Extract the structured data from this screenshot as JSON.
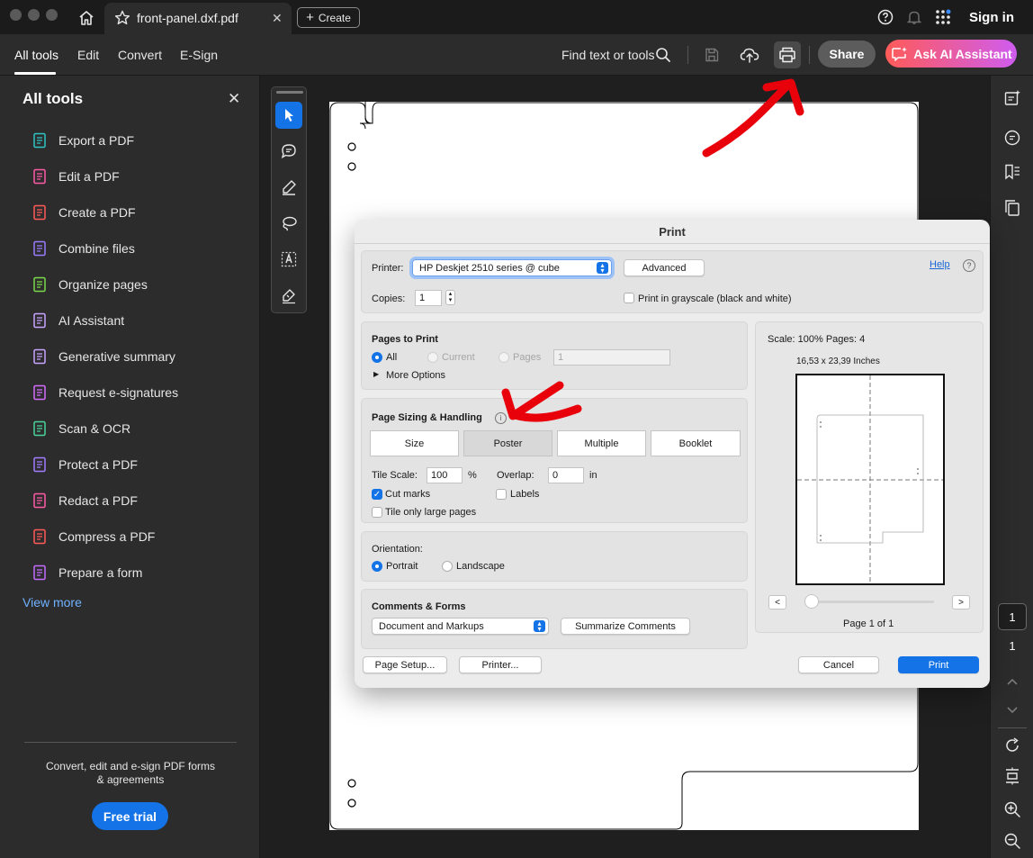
{
  "titlebar": {
    "doc_tab": "front-panel.dxf.pdf",
    "close_glyph": "✕",
    "create_label": "Create",
    "signin_label": "Sign in"
  },
  "toolbar": {
    "tabs": [
      {
        "label": "All tools"
      },
      {
        "label": "Edit"
      },
      {
        "label": "Convert"
      },
      {
        "label": "E-Sign"
      }
    ],
    "find_label": "Find text or tools",
    "share_label": "Share",
    "ai_label": "Ask AI Assistant"
  },
  "left_panel": {
    "title": "All tools",
    "close_glyph": "✕",
    "items": [
      {
        "label": "Export a PDF",
        "icon": "export-pdf-icon",
        "color": "#2ec5c5"
      },
      {
        "label": "Edit a PDF",
        "icon": "edit-pdf-icon",
        "color": "#ff5aa8"
      },
      {
        "label": "Create a PDF",
        "icon": "create-pdf-icon",
        "color": "#ff5a5a"
      },
      {
        "label": "Combine files",
        "icon": "combine-files-icon",
        "color": "#9a7bff"
      },
      {
        "label": "Organize pages",
        "icon": "organize-pages-icon",
        "color": "#7ad94a"
      },
      {
        "label": "AI Assistant",
        "icon": "ai-assistant-icon",
        "color": "#c9a4ff"
      },
      {
        "label": "Generative summary",
        "icon": "generative-summary-icon",
        "color": "#c9a4ff"
      },
      {
        "label": "Request e-signatures",
        "icon": "request-esign-icon",
        "color": "#d46cff"
      },
      {
        "label": "Scan & OCR",
        "icon": "scan-ocr-icon",
        "color": "#4ad49a"
      },
      {
        "label": "Protect a PDF",
        "icon": "protect-pdf-icon",
        "color": "#a27bff"
      },
      {
        "label": "Redact a PDF",
        "icon": "redact-pdf-icon",
        "color": "#ff5aa8"
      },
      {
        "label": "Compress a PDF",
        "icon": "compress-pdf-icon",
        "color": "#ff5a5a"
      },
      {
        "label": "Prepare a form",
        "icon": "prepare-form-icon",
        "color": "#c26cff"
      }
    ],
    "view_more": "View more",
    "promo_line1": "Convert, edit and e-sign PDF forms",
    "promo_line2": "& agreements",
    "free_trial": "Free trial"
  },
  "right_rail": {
    "current_page": "1",
    "total_pages": "1"
  },
  "print_dialog": {
    "title": "Print",
    "printer_label": "Printer:",
    "printer_value": "HP Deskjet 2510 series @ cube",
    "advanced_label": "Advanced",
    "help_label": "Help",
    "help_glyph": "?",
    "copies_label": "Copies:",
    "copies_value": "1",
    "grayscale_label": "Print in grayscale (black and white)",
    "pages_section": {
      "title": "Pages to Print",
      "all": "All",
      "current": "Current",
      "pages": "Pages",
      "pages_value": "1",
      "more_options": "More Options"
    },
    "sizing_section": {
      "title": "Page Sizing & Handling",
      "info_glyph": "i",
      "buttons": [
        "Size",
        "Poster",
        "Multiple",
        "Booklet"
      ],
      "selected": "Poster",
      "tile_scale_label": "Tile Scale:",
      "tile_scale_value": "100",
      "percent": "%",
      "overlap_label": "Overlap:",
      "overlap_value": "0",
      "overlap_unit": "in",
      "cut_marks": "Cut marks",
      "labels": "Labels",
      "tile_large": "Tile only large pages"
    },
    "orientation_section": {
      "title": "Orientation:",
      "portrait": "Portrait",
      "landscape": "Landscape"
    },
    "comments_section": {
      "title": "Comments & Forms",
      "value": "Document and Markups",
      "summarize": "Summarize Comments"
    },
    "preview": {
      "scale_text": "Scale: 100% Pages: 4",
      "size_text": "16,53 x 23,39 Inches",
      "prev": "<",
      "next": ">",
      "page_text": "Page 1 of 1"
    },
    "footer": {
      "page_setup": "Page Setup...",
      "printer": "Printer...",
      "cancel": "Cancel",
      "print": "Print"
    }
  },
  "colors": {
    "accent": "#1473e6",
    "annotation_arrow": "#e8000b"
  }
}
